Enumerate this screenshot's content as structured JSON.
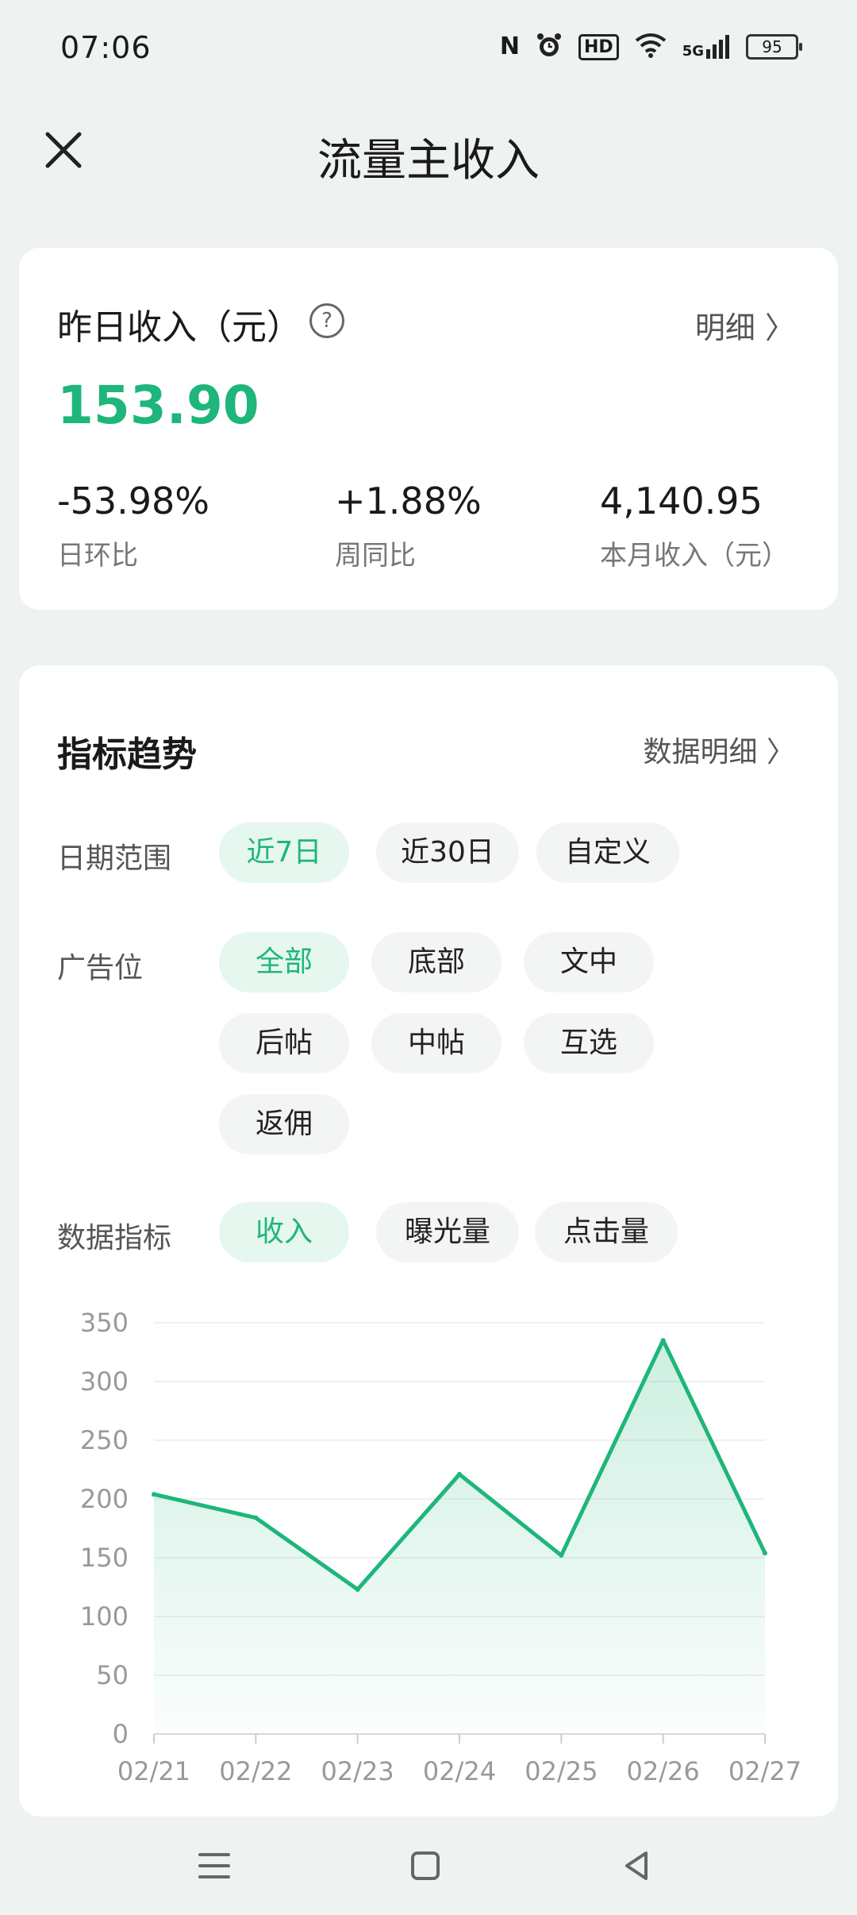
{
  "status": {
    "time": "07:06",
    "nfc": "N",
    "hd": "HD",
    "network": "5G",
    "battery": "95"
  },
  "header": {
    "title": "流量主收入"
  },
  "income_card": {
    "label": "昨日收入（元）",
    "help_symbol": "?",
    "detail_link": "明细 〉",
    "amount": "153.90",
    "metrics": [
      {
        "value": "-53.98%",
        "label": "日环比"
      },
      {
        "value": "+1.88%",
        "label": "周同比"
      },
      {
        "value": "4,140.95",
        "label": "本月收入（元）"
      }
    ]
  },
  "trend_card": {
    "title": "指标趋势",
    "detail_link": "数据明细 〉",
    "date_range": {
      "label": "日期范围",
      "options": [
        "近7日",
        "近30日",
        "自定义"
      ],
      "selected": "近7日"
    },
    "ad_position": {
      "label": "广告位",
      "options": [
        "全部",
        "底部",
        "文中",
        "后帖",
        "中帖",
        "互选",
        "返佣"
      ],
      "selected": "全部"
    },
    "metric": {
      "label": "数据指标",
      "options": [
        "收入",
        "曝光量",
        "点击量"
      ],
      "selected": "收入"
    }
  },
  "chart_data": {
    "type": "area",
    "x": [
      "02/21",
      "02/22",
      "02/23",
      "02/24",
      "02/25",
      "02/26",
      "02/27"
    ],
    "series": [
      {
        "values": [
          204,
          184,
          123,
          221,
          152,
          335,
          154
        ]
      }
    ],
    "yticks": [
      0,
      50,
      100,
      150,
      200,
      250,
      300,
      350
    ],
    "ylim": [
      0,
      350
    ],
    "grid": true,
    "color": "#1eb67a"
  },
  "colors": {
    "accent": "#1eb67a",
    "chip_active_bg": "#e6f7ef"
  }
}
